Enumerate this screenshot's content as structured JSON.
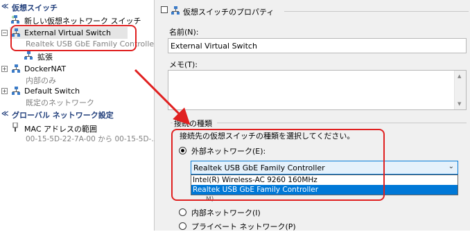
{
  "tree": {
    "virtual_switches_header": "仮想スイッチ",
    "new_switch_label": "新しい仮想ネットワーク スイッチ",
    "switches": [
      {
        "name": "External Virtual Switch",
        "sub": "Realtek USB GbE Family Controller",
        "child": "拡張"
      },
      {
        "name": "DockerNAT",
        "sub": "内部のみ"
      },
      {
        "name": "Default Switch",
        "sub": "既定のネットワーク"
      }
    ],
    "global_header": "グローバル ネットワーク設定",
    "mac_range": {
      "name": "MAC アドレスの範囲",
      "sub": "00-15-5D-22-7A-00 から 00-15-5D-..."
    }
  },
  "properties": {
    "title": "仮想スイッチのプロパティ",
    "name_label": "名前(N):",
    "name_value": "External Virtual Switch",
    "memo_label": "メモ(T):",
    "connection_type_header": "接続の種類",
    "connection_prompt": "接続先の仮想スイッチの種類を選択してください。",
    "external_label": "外部ネットワーク(E):",
    "adapter_selected": "Realtek USB GbE Family Controller",
    "adapter_options": [
      "Intel(R) Wireless-AC 9260 160MHz",
      "Realtek USB GbE Family Controller"
    ],
    "internal_label": "内部ネットワーク(I)",
    "private_label": "プライベート ネットワーク(P)",
    "hidden_fragment": "M)"
  },
  "colors": {
    "accent": "#1f3d7a",
    "highlight": "#0078d7",
    "annotation": "#e02020"
  }
}
